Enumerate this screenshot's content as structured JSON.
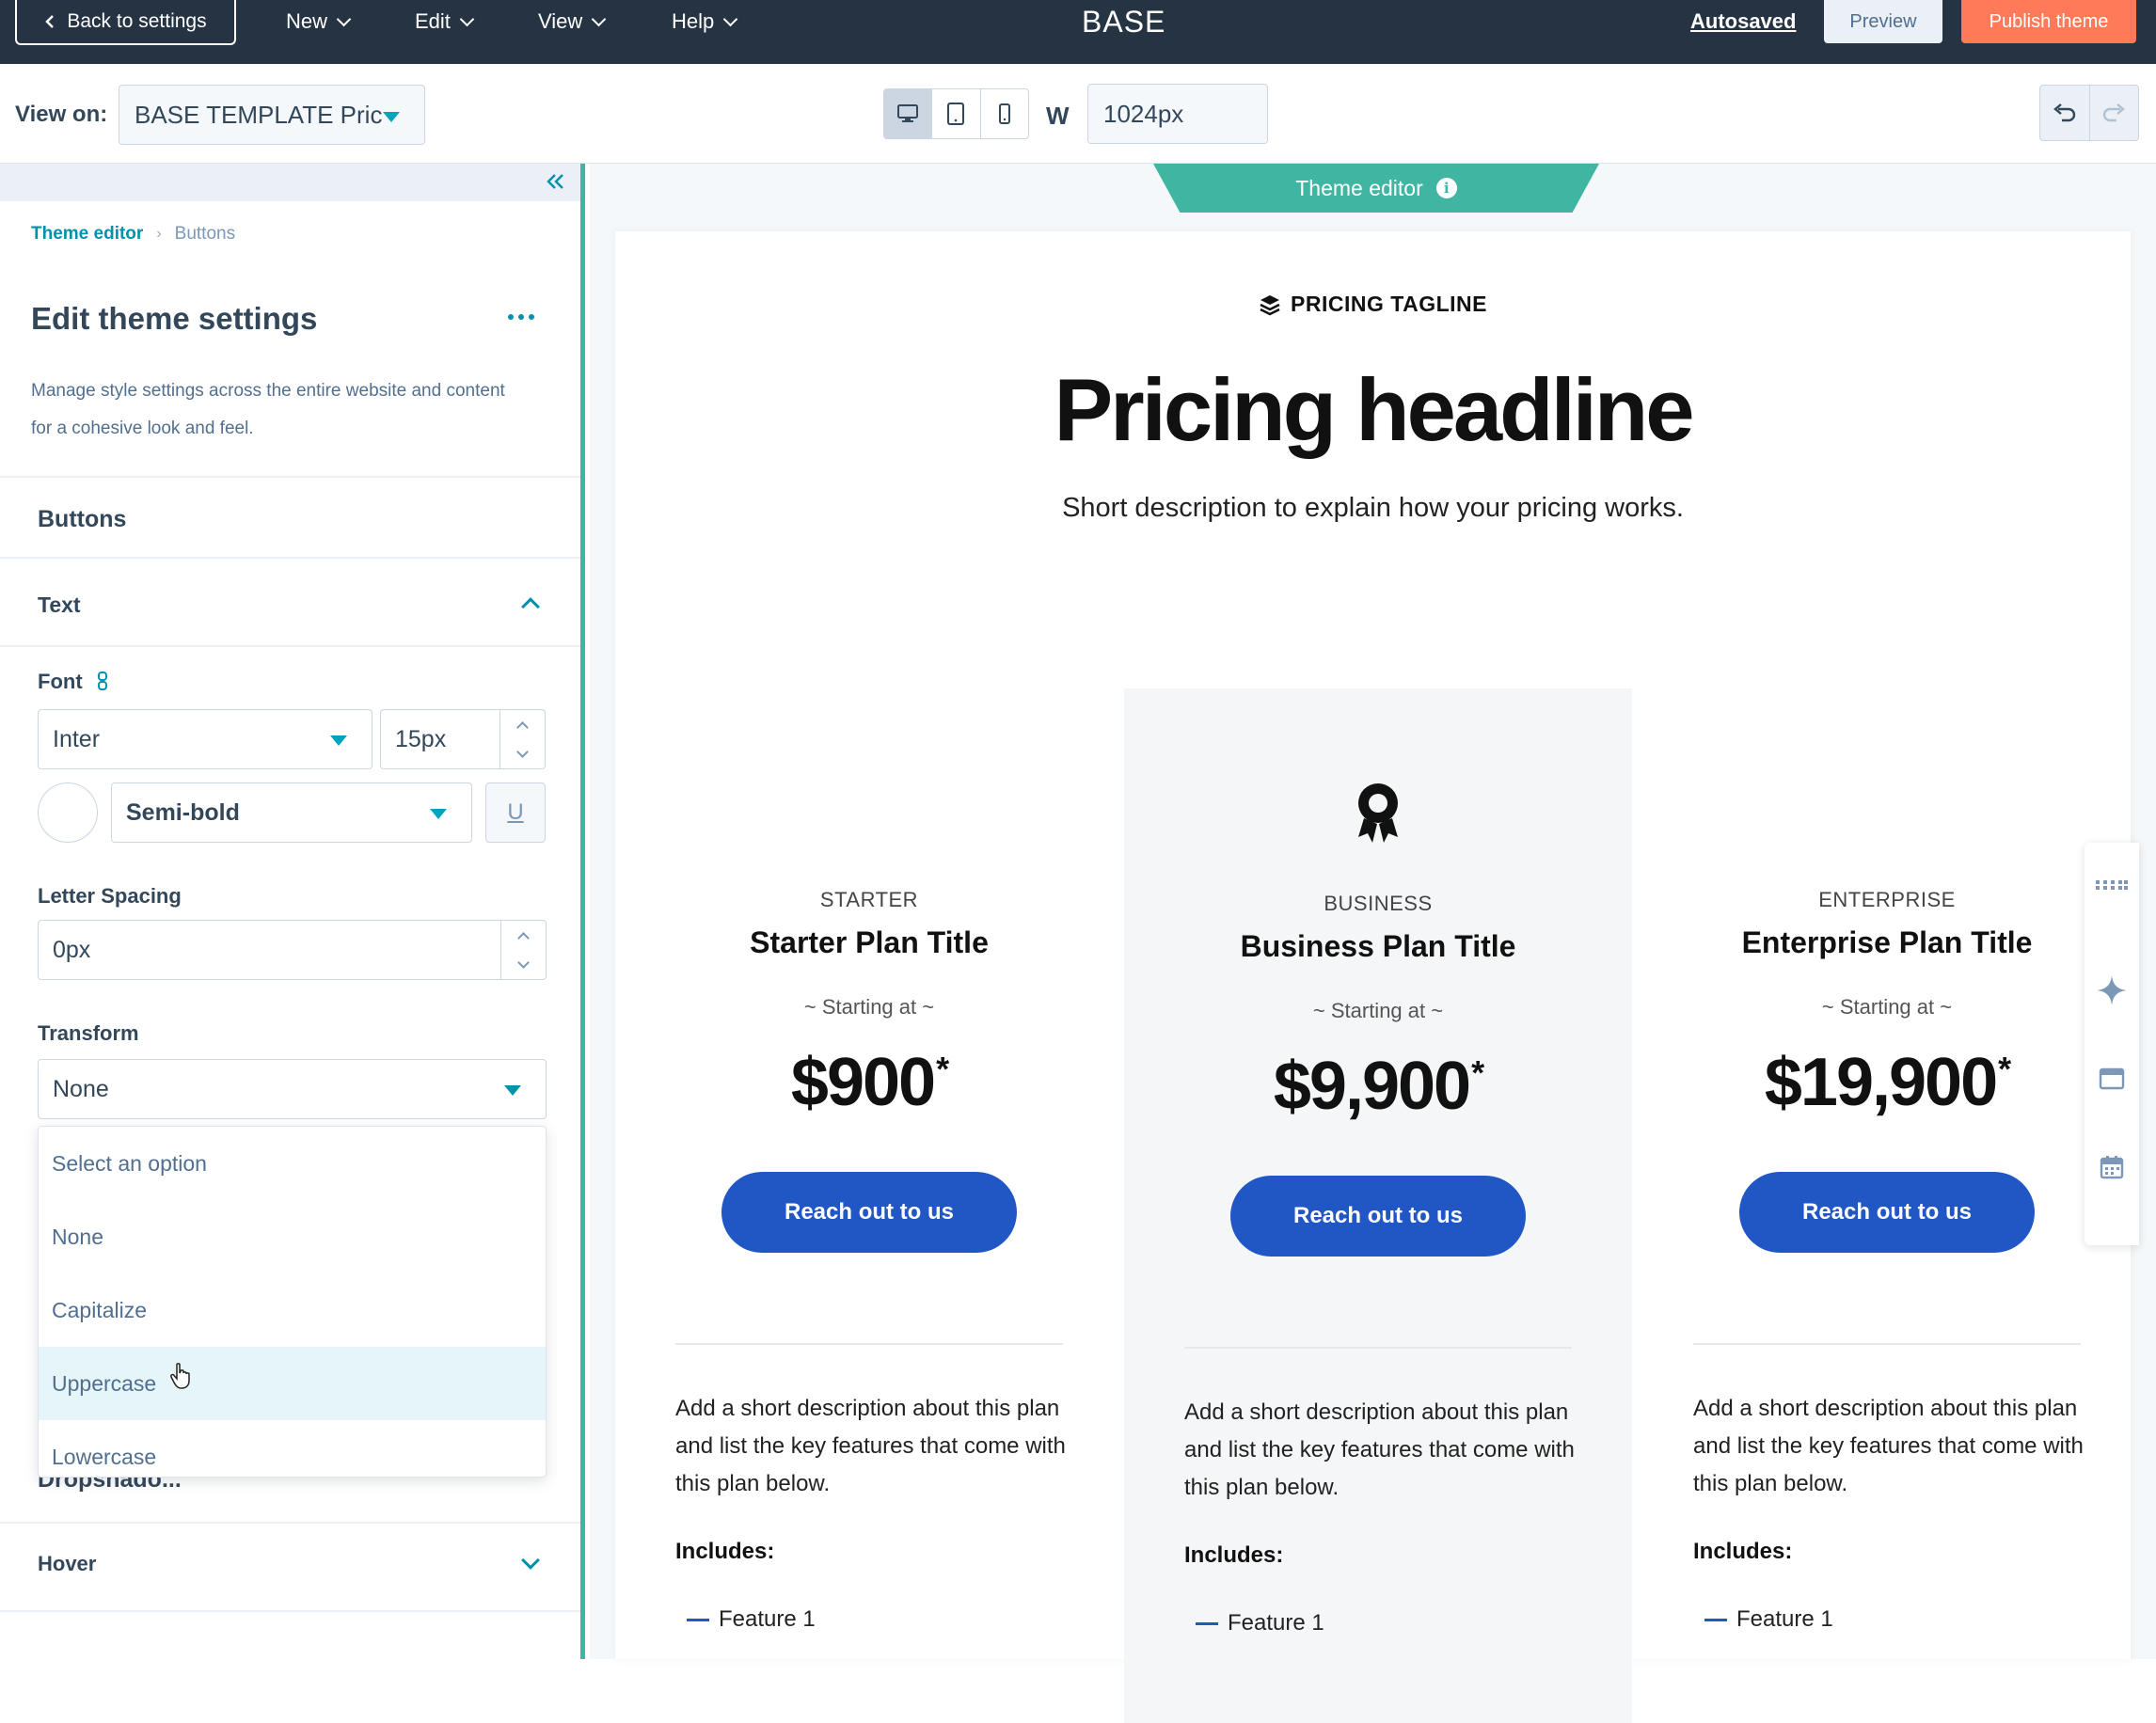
{
  "topbar": {
    "back_label": "Back to settings",
    "menus": [
      "New",
      "Edit",
      "View",
      "Help"
    ],
    "app_title": "BASE",
    "autosaved": "Autosaved",
    "preview": "Preview",
    "publish": "Publish theme"
  },
  "viewbar": {
    "view_on_label": "View on:",
    "view_on_value": "BASE TEMPLATE Pric",
    "width_label": "W",
    "width_value": "1024px",
    "active_device": "desktop"
  },
  "panel": {
    "breadcrumb": {
      "root": "Theme editor",
      "current": "Buttons"
    },
    "title": "Edit theme settings",
    "description": "Manage style settings across the entire website and content for a cohesive look and feel.",
    "section": "Buttons",
    "text_group": "Text",
    "font_label": "Font",
    "font_family": "Inter",
    "font_size": "15px",
    "font_weight": "Semi-bold",
    "underline_glyph": "U",
    "letter_spacing_label": "Letter Spacing",
    "letter_spacing_value": "0px",
    "transform_label": "Transform",
    "transform_value": "None",
    "transform_options": [
      "Select an option",
      "None",
      "Capitalize",
      "Uppercase",
      "Lowercase"
    ],
    "hovered_option": "Uppercase",
    "obscured_label": "Dropshado...",
    "hover_group": "Hover"
  },
  "canvas": {
    "theme_editor_tab": "Theme editor",
    "tagline": "PRICING TAGLINE",
    "headline": "Pricing headline",
    "subhead": "Short description to explain how your pricing works.",
    "plans": [
      {
        "tier": "STARTER",
        "title": "Starter Plan Title",
        "starting": "~ Starting at ~",
        "price": "$900",
        "asterisk": "*",
        "cta": "Reach out to us",
        "description": "Add a short description about this plan and list the key features that come with this plan below.",
        "includes": "Includes:",
        "feature": "Feature 1"
      },
      {
        "tier": "BUSINESS",
        "title": "Business Plan Title",
        "starting": "~ Starting at ~",
        "price": "$9,900",
        "asterisk": "*",
        "cta": "Reach out to us",
        "description": "Add a short description about this plan and list the key features that come with this plan below.",
        "includes": "Includes:",
        "feature": "Feature 1"
      },
      {
        "tier": "ENTERPRISE",
        "title": "Enterprise Plan Title",
        "starting": "~ Starting at ~",
        "price": "$19,900",
        "asterisk": "*",
        "cta": "Reach out to us",
        "description": "Add a short description about this plan and list the key features that come with this plan below.",
        "includes": "Includes:",
        "feature": "Feature 1"
      }
    ]
  },
  "colors": {
    "nav_bg": "#253342",
    "accent_teal": "#3fb5a2",
    "link": "#0091ae",
    "publish": "#ff7a59",
    "cta_blue": "#2157c4"
  },
  "icons": [
    "chevron-left-icon",
    "chevron-down-icon",
    "desktop-icon",
    "tablet-icon",
    "mobile-icon",
    "undo-icon",
    "redo-icon",
    "double-chevron-left-icon",
    "more-icon",
    "link-icon",
    "info-icon",
    "stack-icon",
    "award-icon",
    "grid-icon",
    "sparkle-icon",
    "browser-icon",
    "calendar-icon",
    "pointer-cursor-icon"
  ]
}
